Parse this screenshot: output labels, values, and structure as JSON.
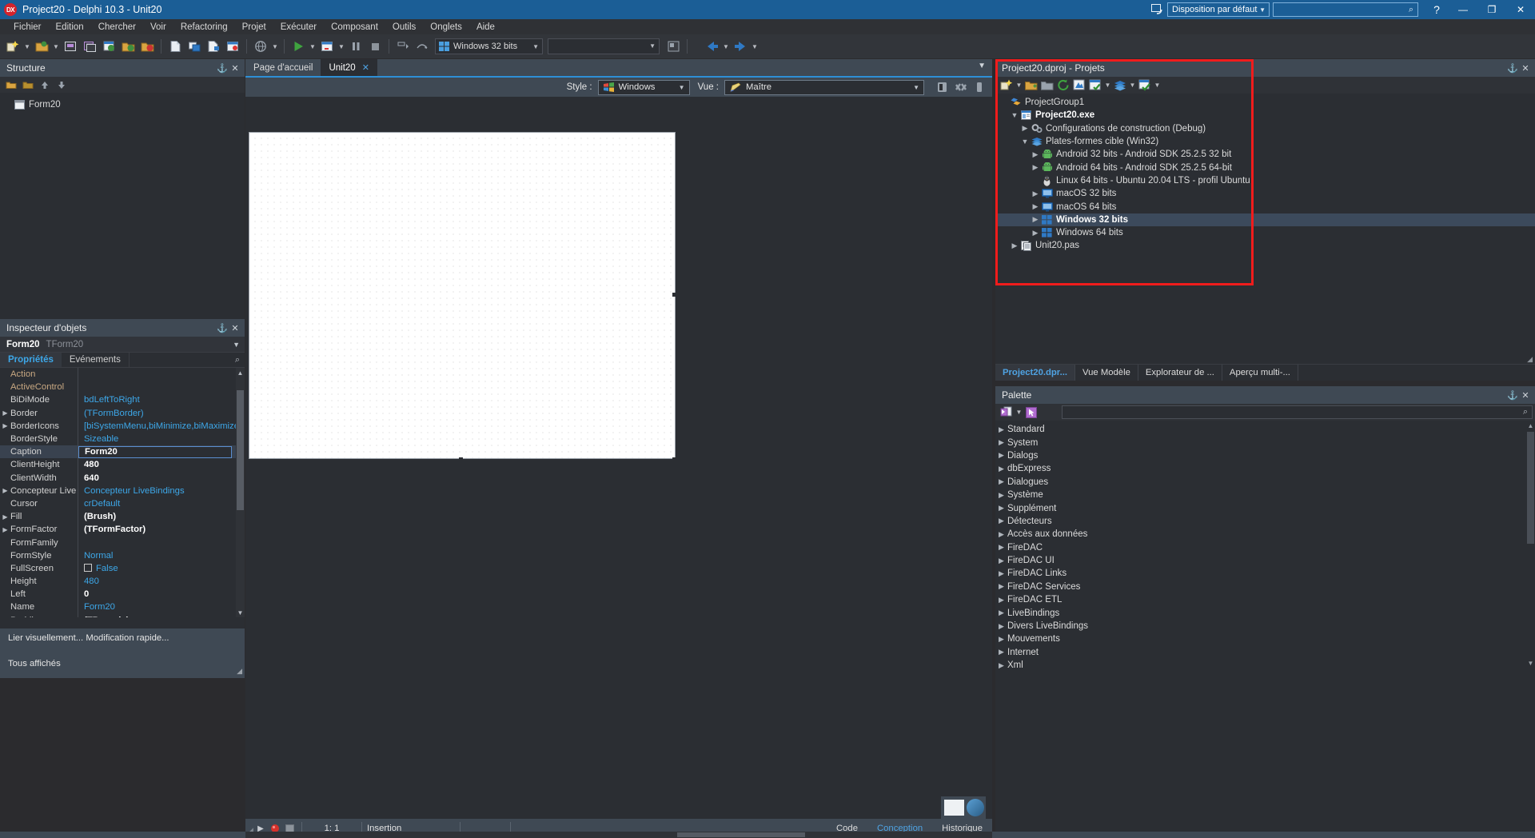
{
  "window": {
    "title": "Project20 - Delphi 10.3 - Unit20",
    "logo_text": "DX",
    "layout_combo": "Disposition par défaut",
    "search_placeholder": "",
    "help_label": "?",
    "minimize": "—",
    "maximize": "❐",
    "close": "✕"
  },
  "menu": {
    "items": [
      {
        "label": "Fichier"
      },
      {
        "label": "Edition"
      },
      {
        "label": "Chercher"
      },
      {
        "label": "Voir"
      },
      {
        "label": "Refactoring"
      },
      {
        "label": "Projet"
      },
      {
        "label": "Exécuter"
      },
      {
        "label": "Composant"
      },
      {
        "label": "Outils"
      },
      {
        "label": "Onglets"
      },
      {
        "label": "Aide"
      }
    ]
  },
  "toolbar": {
    "platform_combo": "Windows 32 bits",
    "config_combo": ""
  },
  "structure": {
    "title": "Structure",
    "pin": "⚓",
    "close": "✕",
    "nodes": [
      {
        "label": "Form20"
      }
    ]
  },
  "inspector": {
    "title": "Inspecteur d'objets",
    "pin": "⚓",
    "close": "✕",
    "object_name": "Form20",
    "object_type": "TForm20",
    "tabs": [
      {
        "label": "Propriétés",
        "active": true
      },
      {
        "label": "Evénements",
        "active": false
      }
    ],
    "filter_value": "",
    "properties": [
      {
        "name": "Action",
        "value": "",
        "expandable": false,
        "dim": true,
        "style": "plain"
      },
      {
        "name": "ActiveControl",
        "value": "",
        "expandable": false,
        "dim": true,
        "style": "plain"
      },
      {
        "name": "BiDiMode",
        "value": "bdLeftToRight",
        "expandable": false,
        "dim": false,
        "style": "link"
      },
      {
        "name": "Border",
        "value": "(TFormBorder)",
        "expandable": true,
        "dim": false,
        "style": "link"
      },
      {
        "name": "BorderIcons",
        "value": "[biSystemMenu,biMinimize,biMaximize]",
        "expandable": true,
        "dim": false,
        "style": "link"
      },
      {
        "name": "BorderStyle",
        "value": "Sizeable",
        "expandable": false,
        "dim": false,
        "style": "link"
      },
      {
        "name": "Caption",
        "value": "Form20",
        "expandable": false,
        "dim": false,
        "style": "editing"
      },
      {
        "name": "ClientHeight",
        "value": "480",
        "expandable": false,
        "dim": false,
        "style": "bold"
      },
      {
        "name": "ClientWidth",
        "value": "640",
        "expandable": false,
        "dim": false,
        "style": "bold"
      },
      {
        "name": "Concepteur Live",
        "value": "Concepteur LiveBindings",
        "expandable": true,
        "dim": false,
        "style": "link"
      },
      {
        "name": "Cursor",
        "value": "crDefault",
        "expandable": false,
        "dim": false,
        "style": "link"
      },
      {
        "name": "Fill",
        "value": "(Brush)",
        "expandable": true,
        "dim": false,
        "style": "bold"
      },
      {
        "name": "FormFactor",
        "value": "(TFormFactor)",
        "expandable": true,
        "dim": false,
        "style": "bold"
      },
      {
        "name": "FormFamily",
        "value": "",
        "expandable": false,
        "dim": false,
        "style": "plain"
      },
      {
        "name": "FormStyle",
        "value": "Normal",
        "expandable": false,
        "dim": false,
        "style": "link"
      },
      {
        "name": "FullScreen",
        "value": "False",
        "expandable": false,
        "dim": false,
        "style": "checkbox"
      },
      {
        "name": "Height",
        "value": "480",
        "expandable": false,
        "dim": false,
        "style": "link"
      },
      {
        "name": "Left",
        "value": "0",
        "expandable": false,
        "dim": false,
        "style": "bold"
      },
      {
        "name": "Name",
        "value": "Form20",
        "expandable": false,
        "dim": false,
        "style": "link"
      },
      {
        "name": "Padding",
        "value": "(TBounds)",
        "expandable": true,
        "dim": false,
        "style": "bold"
      }
    ],
    "selected_property": "Caption",
    "footer_links": "Lier visuellement...  Modification rapide...",
    "footer_status": "Tous affichés"
  },
  "editor": {
    "tabs": [
      {
        "label": "Page d'accueil",
        "active": false,
        "closable": false
      },
      {
        "label": "Unit20",
        "active": true,
        "closable": true,
        "close": "✕"
      }
    ],
    "designer": {
      "style_label": "Style :",
      "style_value": "Windows",
      "view_label": "Vue :",
      "view_value": "Maître"
    },
    "status": {
      "position": "1: 1",
      "mode": "Insertion",
      "tabs": [
        {
          "label": "Code",
          "active": false
        },
        {
          "label": "Conception",
          "active": true
        },
        {
          "label": "Historique",
          "active": false
        }
      ]
    }
  },
  "projects": {
    "title": "Project20.dproj - Projets",
    "pin": "⚓",
    "close": "✕",
    "tree": [
      {
        "label": "ProjectGroup1",
        "indent": 0,
        "expander": "",
        "icon": "group-icon",
        "bold": false,
        "selected": false
      },
      {
        "label": "Project20.exe",
        "indent": 1,
        "expander": "v",
        "icon": "exe-icon",
        "bold": true,
        "selected": false
      },
      {
        "label": "Configurations de construction (Debug)",
        "indent": 2,
        "expander": ">",
        "icon": "gears-icon",
        "bold": false,
        "selected": false
      },
      {
        "label": "Plates-formes cible (Win32)",
        "indent": 2,
        "expander": "v",
        "icon": "layers-icon",
        "bold": false,
        "selected": false
      },
      {
        "label": "Android 32 bits - Android SDK 25.2.5 32 bit",
        "indent": 3,
        "expander": ">",
        "icon": "android-icon",
        "bold": false,
        "selected": false
      },
      {
        "label": "Android 64 bits - Android SDK 25.2.5 64-bit",
        "indent": 3,
        "expander": ">",
        "icon": "android-icon",
        "bold": false,
        "selected": false
      },
      {
        "label": "Linux 64 bits - Ubuntu 20.04 LTS - profil Ubuntu",
        "indent": 3,
        "expander": "",
        "icon": "linux-icon",
        "bold": false,
        "selected": false
      },
      {
        "label": "macOS 32 bits",
        "indent": 3,
        "expander": ">",
        "icon": "monitor-icon",
        "bold": false,
        "selected": false
      },
      {
        "label": "macOS 64 bits",
        "indent": 3,
        "expander": ">",
        "icon": "monitor-icon",
        "bold": false,
        "selected": false
      },
      {
        "label": "Windows 32 bits",
        "indent": 3,
        "expander": ">",
        "icon": "windows-icon",
        "bold": true,
        "selected": true
      },
      {
        "label": "Windows 64 bits",
        "indent": 3,
        "expander": ">",
        "icon": "windows-icon",
        "bold": false,
        "selected": false
      },
      {
        "label": "Unit20.pas",
        "indent": 1,
        "expander": ">",
        "icon": "unit-icon",
        "bold": false,
        "selected": false
      }
    ],
    "tabs": [
      {
        "label": "Project20.dpr...",
        "active": true
      },
      {
        "label": "Vue Modèle",
        "active": false
      },
      {
        "label": "Explorateur de ...",
        "active": false
      },
      {
        "label": "Aperçu multi-...",
        "active": false
      }
    ]
  },
  "palette": {
    "title": "Palette",
    "pin": "⚓",
    "close": "✕",
    "search_value": "",
    "categories": [
      {
        "label": "Standard"
      },
      {
        "label": "System"
      },
      {
        "label": "Dialogs"
      },
      {
        "label": "dbExpress"
      },
      {
        "label": "Dialogues"
      },
      {
        "label": "Système"
      },
      {
        "label": "Supplément"
      },
      {
        "label": "Détecteurs"
      },
      {
        "label": "Accès aux données"
      },
      {
        "label": "FireDAC"
      },
      {
        "label": "FireDAC UI"
      },
      {
        "label": "FireDAC Links"
      },
      {
        "label": "FireDAC Services"
      },
      {
        "label": "FireDAC ETL"
      },
      {
        "label": "LiveBindings"
      },
      {
        "label": "Divers LiveBindings"
      },
      {
        "label": "Mouvements"
      },
      {
        "label": "Internet"
      },
      {
        "label": "Xml"
      }
    ]
  },
  "colors": {
    "accent_blue": "#1b5e96",
    "link_blue": "#3da7e8",
    "panel_header": "#3f4954",
    "panel_bg": "#2b2e33",
    "selection": "#3c4a5c",
    "highlight_red": "#f01c1c"
  }
}
